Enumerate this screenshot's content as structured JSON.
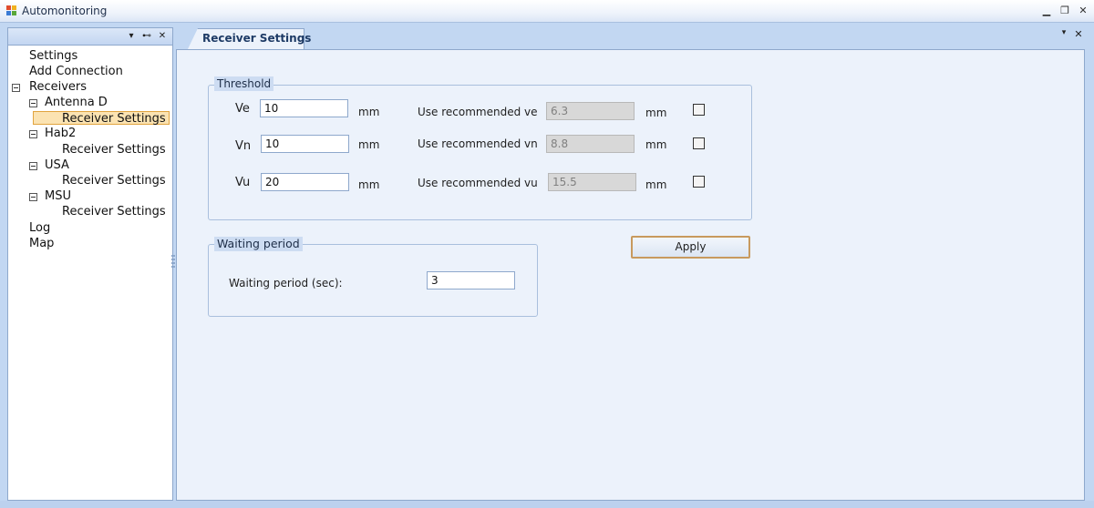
{
  "window": {
    "title": "Automonitoring",
    "minimize_glyph": "▁",
    "restore_glyph": "❐",
    "close_glyph": "✕"
  },
  "nav": {
    "header_buttons": {
      "dropdown": "▾",
      "pin": "⊷",
      "close": "✕"
    },
    "tree": [
      {
        "label": "Settings"
      },
      {
        "label": "Add Connection"
      },
      {
        "label": "Receivers"
      },
      {
        "label": "Antenna D"
      },
      {
        "label": "Receiver Settings",
        "selected": true
      },
      {
        "label": "Hab2"
      },
      {
        "label": "Receiver Settings"
      },
      {
        "label": "USA"
      },
      {
        "label": "Receiver Settings"
      },
      {
        "label": "MSU"
      },
      {
        "label": "Receiver Settings"
      },
      {
        "label": "Log"
      },
      {
        "label": "Map"
      }
    ]
  },
  "tab": {
    "label": "Receiver Settings",
    "dropdown_glyph": "▾",
    "close_glyph": "✕"
  },
  "threshold": {
    "title": "Threshold",
    "rows": [
      {
        "label": "Ve",
        "value": "10",
        "unit": "mm",
        "rec_label": "Use recommended ve",
        "rec_value": "6.3",
        "rec_unit": "mm",
        "checked": false
      },
      {
        "label": "Vn",
        "value": "10",
        "unit": "mm",
        "rec_label": "Use recommended vn",
        "rec_value": "8.8",
        "rec_unit": "mm",
        "checked": false
      },
      {
        "label": "Vu",
        "value": "20",
        "unit": "mm",
        "rec_label": "Use recommended vu",
        "rec_value": "15.5",
        "rec_unit": "mm",
        "checked": false
      }
    ]
  },
  "waiting": {
    "title": "Waiting period",
    "label": "Waiting period (sec):",
    "value": "3"
  },
  "apply_label": "Apply",
  "icons": {
    "app": "app-icon",
    "toggle": "minus-box-icon"
  },
  "colors": {
    "selected_bg": "#fbe3b2",
    "selected_border": "#e1a43f",
    "apply_border": "#c89a5e"
  }
}
